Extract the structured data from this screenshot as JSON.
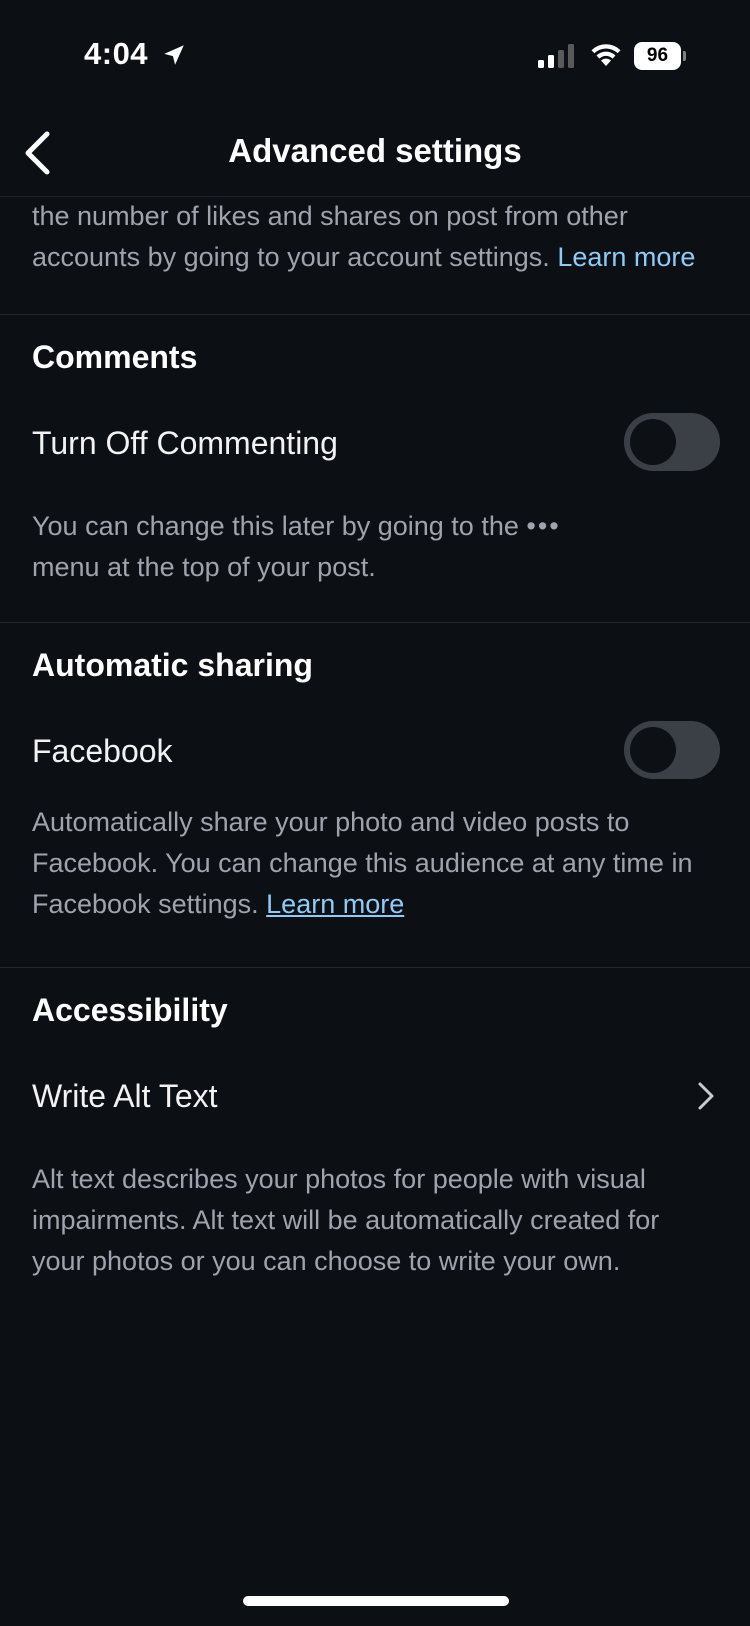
{
  "status_bar": {
    "time": "4:04",
    "battery": "96"
  },
  "header": {
    "title": "Advanced settings",
    "back_icon": "chevron-left-icon"
  },
  "top_description": {
    "text": "the number of likes and shares on post from other accounts by going to your account settings.",
    "link": "Learn more"
  },
  "comments": {
    "title": "Comments",
    "toggle_label": "Turn Off Commenting",
    "toggle_on": false,
    "description_before": "You can change this later by going to the",
    "menu_glyph": "•••",
    "description_after": "menu at the top of your post."
  },
  "automatic_sharing": {
    "title": "Automatic sharing",
    "toggle_label": "Facebook",
    "toggle_on": false,
    "description": "Automatically share your photo and video posts to Facebook. You can change this audience at any time in Facebook settings.",
    "link": "Learn more"
  },
  "accessibility": {
    "title": "Accessibility",
    "row_label": "Write Alt Text",
    "description": "Alt text describes your photos for people with visual impairments. Alt text will be automatically created for your photos or you can choose to write your own."
  },
  "colors": {
    "background": "#0c0f14",
    "secondary_text": "#9ea3ad",
    "link": "#8ecbf5",
    "toggle_off": "#3b3f46"
  }
}
